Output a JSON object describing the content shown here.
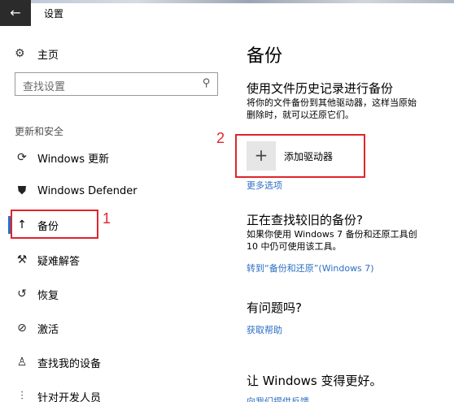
{
  "window": {
    "title": "设置",
    "back_glyph": "←"
  },
  "sidebar": {
    "home_label": "主页",
    "home_icon": "gear-icon",
    "search_placeholder": "查找设置",
    "section_title": "更新和安全",
    "items": [
      {
        "label": "Windows 更新",
        "icon": "sync-icon",
        "glyph": "⟳"
      },
      {
        "label": "Windows Defender",
        "icon": "shield-icon",
        "glyph": "⛊"
      },
      {
        "label": "备份",
        "icon": "backup-arrow-icon",
        "glyph": "↑",
        "selected": true
      },
      {
        "label": "疑难解答",
        "icon": "wrench-icon",
        "glyph": "🔧"
      },
      {
        "label": "恢复",
        "icon": "history-icon",
        "glyph": "↺"
      },
      {
        "label": "激活",
        "icon": "check-circle-icon",
        "glyph": "✓"
      },
      {
        "label": "查找我的设备",
        "icon": "person-location-icon",
        "glyph": "⚲"
      },
      {
        "label": "针对开发人员",
        "icon": "developer-tools-icon",
        "glyph": "⚙"
      }
    ]
  },
  "main": {
    "title": "备份",
    "file_history": {
      "heading": "使用文件历史记录进行备份",
      "line1": "将你的文件备份到其他驱动器，这样当原始",
      "line2": "删除时，就可以还原它们。",
      "add_drive_label": "添加驱动器",
      "more_options": "更多选项"
    },
    "older_backup": {
      "heading": "正在查找较旧的备份?",
      "line1": "如果你使用 Windows 7 备份和还原工具创",
      "line2": "10 中仍可使用该工具。",
      "link": "转到“备份和还原”(Windows 7)"
    },
    "question": {
      "heading": "有问题吗?",
      "link": "获取帮助"
    },
    "improve": {
      "heading": "让 Windows 变得更好。",
      "link": "向我们提供反馈"
    }
  },
  "annotations": {
    "label1": "1",
    "label2": "2",
    "color": "#e0252b"
  },
  "colors": {
    "accent": "#2b6fc4",
    "titlebar_back": "#2b2b2b"
  }
}
